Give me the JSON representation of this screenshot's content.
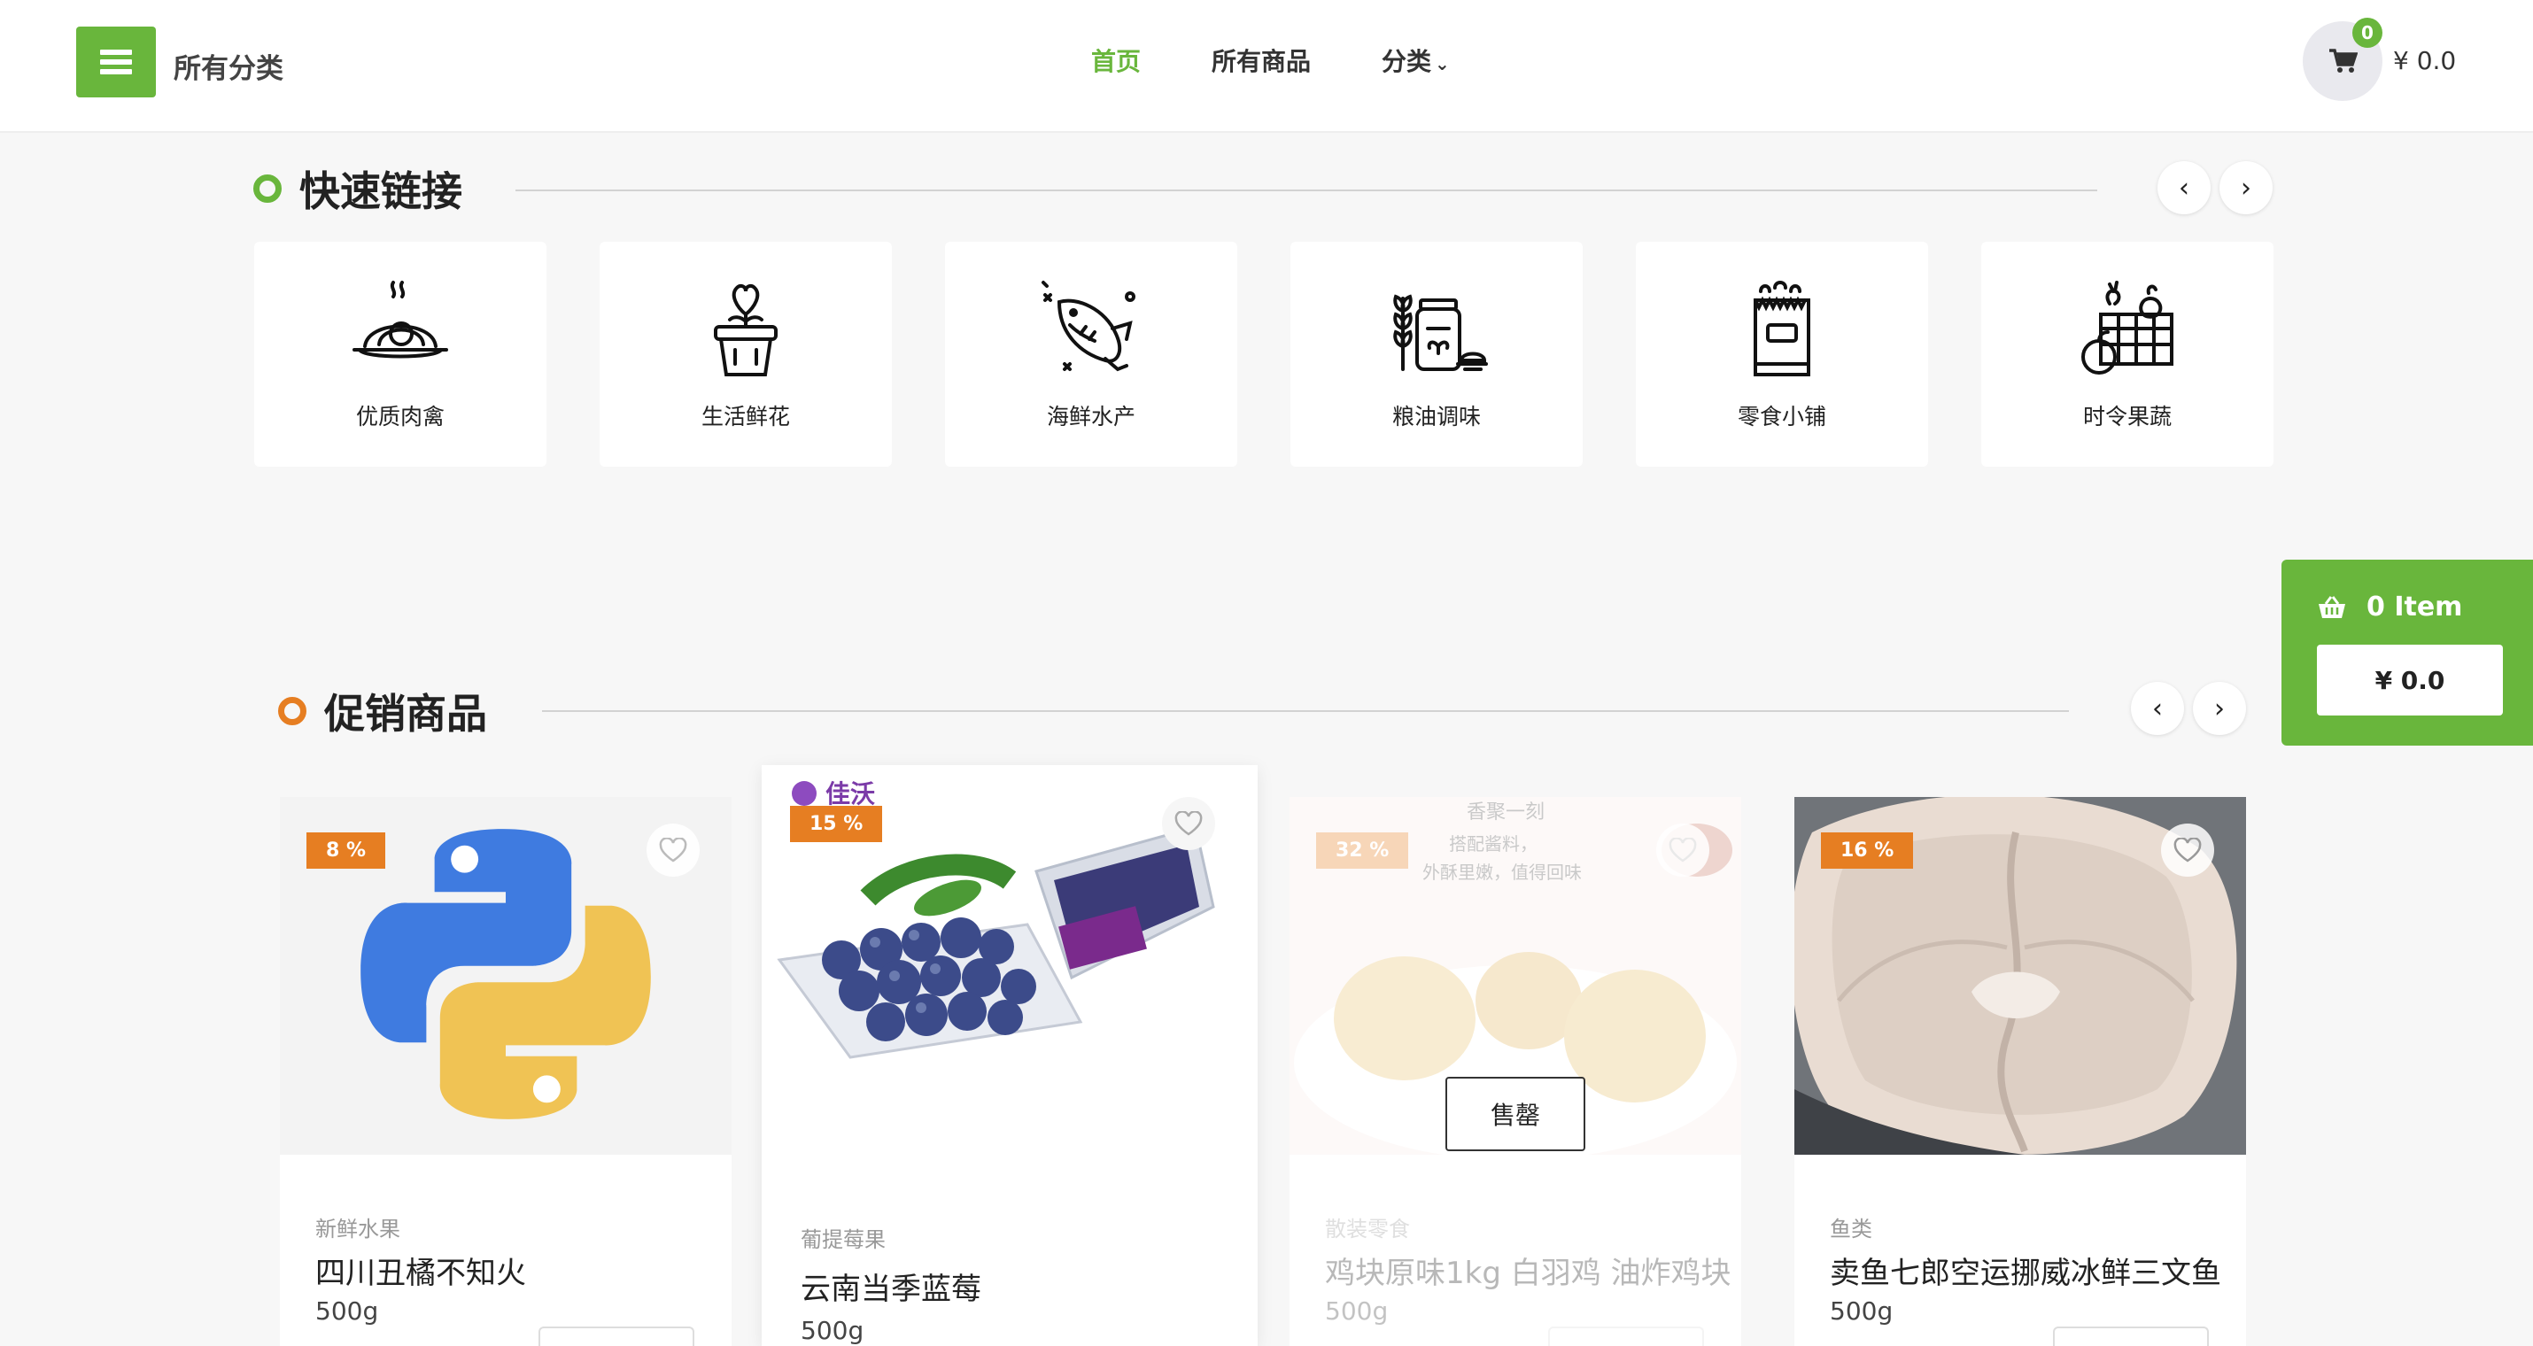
{
  "header": {
    "all_categories": "所有分类",
    "nav": [
      {
        "label": "首页",
        "active": true
      },
      {
        "label": "所有商品",
        "active": false
      },
      {
        "label": "分类",
        "active": false
      }
    ],
    "cart_count": "0",
    "cart_total": "¥ 0.0"
  },
  "quick_links": {
    "title": "快速链接",
    "items": [
      {
        "label": "优质肉禽",
        "icon": "meat-plate-icon"
      },
      {
        "label": "生活鲜花",
        "icon": "flower-pot-icon"
      },
      {
        "label": "海鲜水产",
        "icon": "fish-icon"
      },
      {
        "label": "粮油调味",
        "icon": "grain-jar-icon"
      },
      {
        "label": "零食小铺",
        "icon": "snack-bag-icon"
      },
      {
        "label": "时令果蔬",
        "icon": "fruit-basket-icon"
      }
    ]
  },
  "side_cart": {
    "items": "0 Item",
    "total": "¥ 0.0"
  },
  "promotions": {
    "title": "促销商品",
    "sold_out_label": "售罄",
    "products": [
      {
        "discount": "8 %",
        "category": "新鲜水果",
        "name": "四川丑橘不知火",
        "weight": "500g",
        "image": "python-logo"
      },
      {
        "discount": "15 %",
        "category": "葡提莓果",
        "name": "云南当季蓝莓",
        "weight": "500g",
        "image": "blueberries"
      },
      {
        "discount": "32 %",
        "category": "散装零食",
        "name": "鸡块原味1kg 白羽鸡 油炸鸡块",
        "weight": "500g",
        "image": "chicken-nuggets",
        "sold_out": true,
        "image_text": {
          "line1": "香聚一刻",
          "line2": "搭配酱料，",
          "line3": "外酥里嫩，值得回味"
        }
      },
      {
        "discount": "16 %",
        "category": "鱼类",
        "name": "卖鱼七郎空运挪威冰鲜三文鱼",
        "weight": "500g",
        "image": "salmon-steak"
      }
    ],
    "blueberry_brand": "佳沃"
  },
  "colors": {
    "accent": "#69b63c",
    "badge": "#e67e22"
  }
}
